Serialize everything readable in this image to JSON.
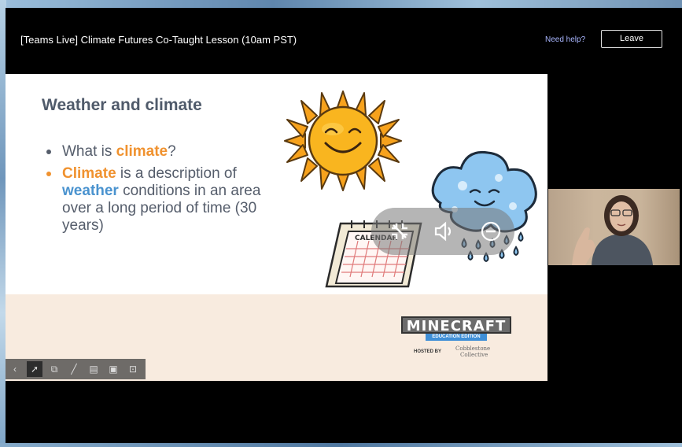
{
  "meeting": {
    "title": "[Teams Live] Climate Futures Co-Taught Lesson (10am PST)",
    "help_link": "Need help?",
    "leave_label": "Leave"
  },
  "slide": {
    "heading": "Weather and climate",
    "bullet1": {
      "pre": "What is ",
      "highlight": "climate",
      "post": "?"
    },
    "bullet2": {
      "highlight1": "Climate",
      "text1": " is a description of ",
      "highlight2": "weather",
      "text2": " conditions in an area over a long period of time (30 years)"
    },
    "calendar_label": "CALENDAR",
    "logo": {
      "word": "MINECRAFT",
      "edition": "EDUCATION EDITION",
      "hosted_by": "HOSTED BY",
      "partner_line1": "Cobblestone",
      "partner_line2": "Collective"
    }
  },
  "media_controls": [
    {
      "name": "fullscreen-exit-icon"
    },
    {
      "name": "volume-icon"
    },
    {
      "name": "zoom-out-icon"
    }
  ],
  "toolbar_icons": [
    {
      "name": "previous-icon",
      "glyph": "‹"
    },
    {
      "name": "pointer-icon",
      "glyph": "➚"
    },
    {
      "name": "copy-icon",
      "glyph": "⧉"
    },
    {
      "name": "pen-icon",
      "glyph": "╱"
    },
    {
      "name": "chat-icon",
      "glyph": "▤"
    },
    {
      "name": "subtitle-icon",
      "glyph": "▣"
    },
    {
      "name": "present-icon",
      "glyph": "⊡"
    }
  ],
  "colors": {
    "accent_orange": "#f0922f",
    "accent_blue": "#4a93cf",
    "help_link": "#a9b6ff"
  }
}
